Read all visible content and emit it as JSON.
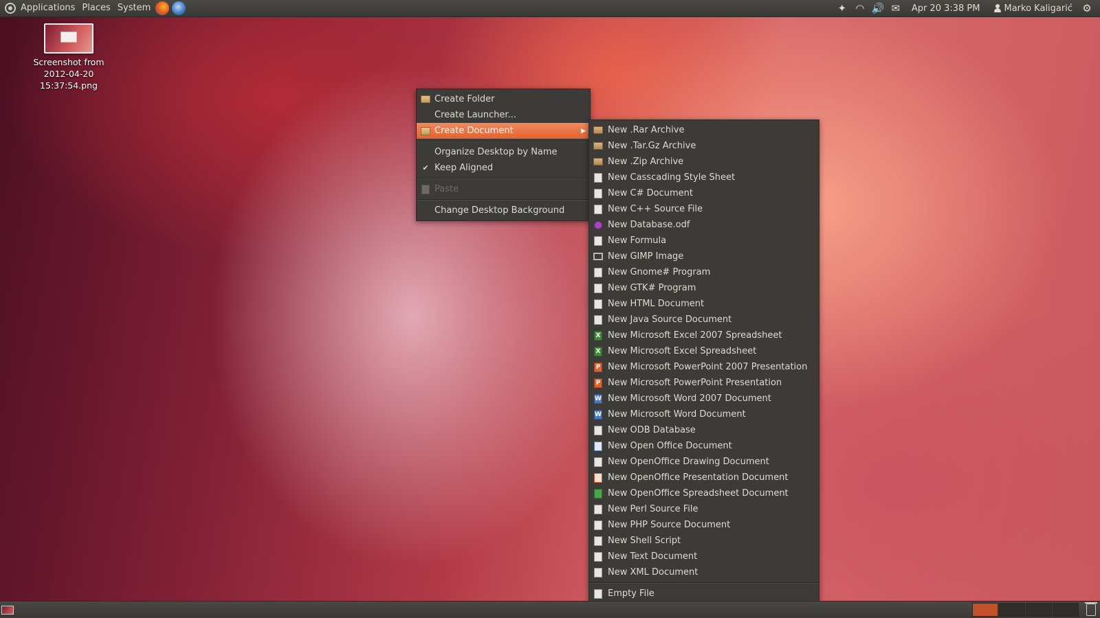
{
  "top_panel": {
    "menus": [
      "Applications",
      "Places",
      "System"
    ],
    "clock": "Apr 20  3:38 PM",
    "user": "Marko Kaligarić"
  },
  "desktop_icon": {
    "label": "Screenshot from\n2012-04-20\n15:37:54.png"
  },
  "context_menu": {
    "items": [
      {
        "label": "Create Folder",
        "icon": "folder-new-icon"
      },
      {
        "label": "Create Launcher...",
        "icon": ""
      },
      {
        "label": "Create Document",
        "icon": "document-new-icon",
        "has_submenu": true,
        "active": true
      },
      {
        "label": "Organize Desktop by Name",
        "icon": ""
      },
      {
        "label": "Keep Aligned",
        "icon": "check-icon"
      },
      {
        "label": "Paste",
        "icon": "paste-icon",
        "disabled": true
      },
      {
        "label": "Change Desktop Background",
        "icon": ""
      }
    ]
  },
  "submenu": {
    "items": [
      {
        "label": "New .Rar Archive",
        "icon": "archive-icon"
      },
      {
        "label": "New .Tar.Gz Archive",
        "icon": "archive-icon"
      },
      {
        "label": "New .Zip Archive",
        "icon": "archive-icon"
      },
      {
        "label": "New Casscading Style Sheet",
        "icon": "text-file-icon"
      },
      {
        "label": "New C# Document",
        "icon": "text-file-icon"
      },
      {
        "label": "New C++ Source File",
        "icon": "text-file-icon"
      },
      {
        "label": "New Database.odf",
        "icon": "database-icon"
      },
      {
        "label": "New Formula",
        "icon": "text-file-icon"
      },
      {
        "label": "New GIMP Image",
        "icon": "gimp-image-icon"
      },
      {
        "label": "New Gnome# Program",
        "icon": "text-file-icon"
      },
      {
        "label": "New GTK# Program",
        "icon": "text-file-icon"
      },
      {
        "label": "New HTML Document",
        "icon": "text-file-icon"
      },
      {
        "label": "New Java Source Document",
        "icon": "text-file-icon"
      },
      {
        "label": "New Microsoft Excel 2007 Spreadsheet",
        "icon": "excel-icon"
      },
      {
        "label": "New Microsoft Excel Spreadsheet",
        "icon": "excel-icon"
      },
      {
        "label": "New Microsoft PowerPoint 2007 Presentation",
        "icon": "powerpoint-icon"
      },
      {
        "label": "New Microsoft PowerPoint Presentation",
        "icon": "powerpoint-icon"
      },
      {
        "label": "New Microsoft Word 2007 Document",
        "icon": "word-icon"
      },
      {
        "label": "New Microsoft Word Document",
        "icon": "word-icon"
      },
      {
        "label": "New ODB Database",
        "icon": "text-file-icon"
      },
      {
        "label": "New Open Office Document",
        "icon": "oo-document-icon"
      },
      {
        "label": "New OpenOffice Drawing Document",
        "icon": "text-file-icon"
      },
      {
        "label": "New OpenOffice Presentation Document",
        "icon": "oo-presentation-icon"
      },
      {
        "label": "New OpenOffice Spreadsheet Document",
        "icon": "oo-spreadsheet-icon"
      },
      {
        "label": "New Perl Source File",
        "icon": "text-file-icon"
      },
      {
        "label": "New PHP Source Document",
        "icon": "text-file-icon"
      },
      {
        "label": "New Shell Script",
        "icon": "text-file-icon"
      },
      {
        "label": "New Text Document",
        "icon": "text-file-icon"
      },
      {
        "label": "New XML Document",
        "icon": "text-file-icon"
      }
    ],
    "empty_file": "Empty File"
  }
}
